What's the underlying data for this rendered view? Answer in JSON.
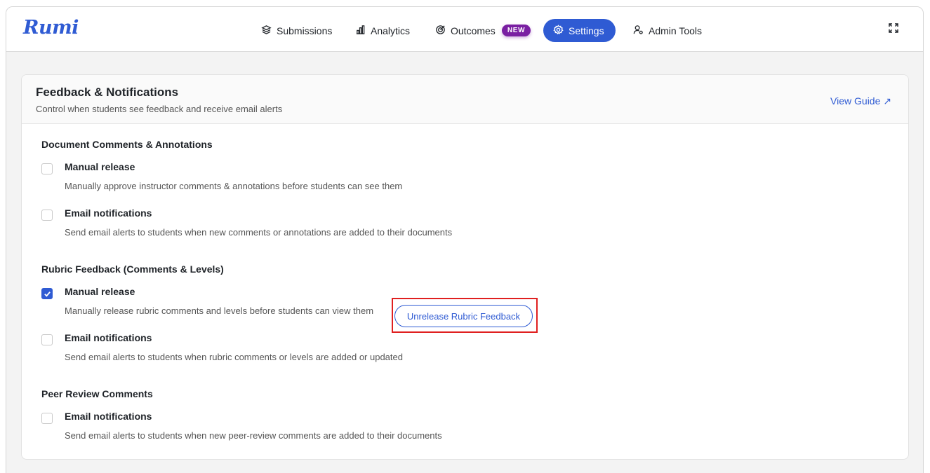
{
  "app": {
    "logo_text": "Rumi",
    "brand_color": "#2f5bd3"
  },
  "nav": {
    "items": [
      {
        "label": "Submissions",
        "icon": "layers-icon"
      },
      {
        "label": "Analytics",
        "icon": "bar-chart-icon"
      },
      {
        "label": "Outcomes",
        "icon": "target-icon",
        "badge": "NEW"
      },
      {
        "label": "Settings",
        "icon": "gear-icon",
        "active": true
      },
      {
        "label": "Admin Tools",
        "icon": "user-cog-icon"
      }
    ],
    "expand_icon": "expand-icon"
  },
  "card": {
    "title": "Feedback & Notifications",
    "subtitle": "Control when students see feedback and receive email alerts",
    "guide_link": "View Guide ↗"
  },
  "sections": [
    {
      "title": "Document Comments & Annotations",
      "options": [
        {
          "label": "Manual release",
          "description": "Manually approve instructor comments & annotations before students can see them",
          "checked": false
        },
        {
          "label": "Email notifications",
          "description": "Send email alerts to students when new comments or annotations are added to their documents",
          "checked": false
        }
      ]
    },
    {
      "title": "Rubric Feedback (Comments & Levels)",
      "options": [
        {
          "label": "Manual release",
          "description": "Manually release rubric comments and levels before students can view them",
          "checked": true,
          "action_button": "Unrelease Rubric Feedback"
        },
        {
          "label": "Email notifications",
          "description": "Send email alerts to students when rubric comments or levels are added or updated",
          "checked": false
        }
      ]
    },
    {
      "title": "Peer Review Comments",
      "options": [
        {
          "label": "Email notifications",
          "description": "Send email alerts to students when new peer-review comments are added to their documents",
          "checked": false
        }
      ]
    }
  ],
  "highlight_color": "#e02020"
}
